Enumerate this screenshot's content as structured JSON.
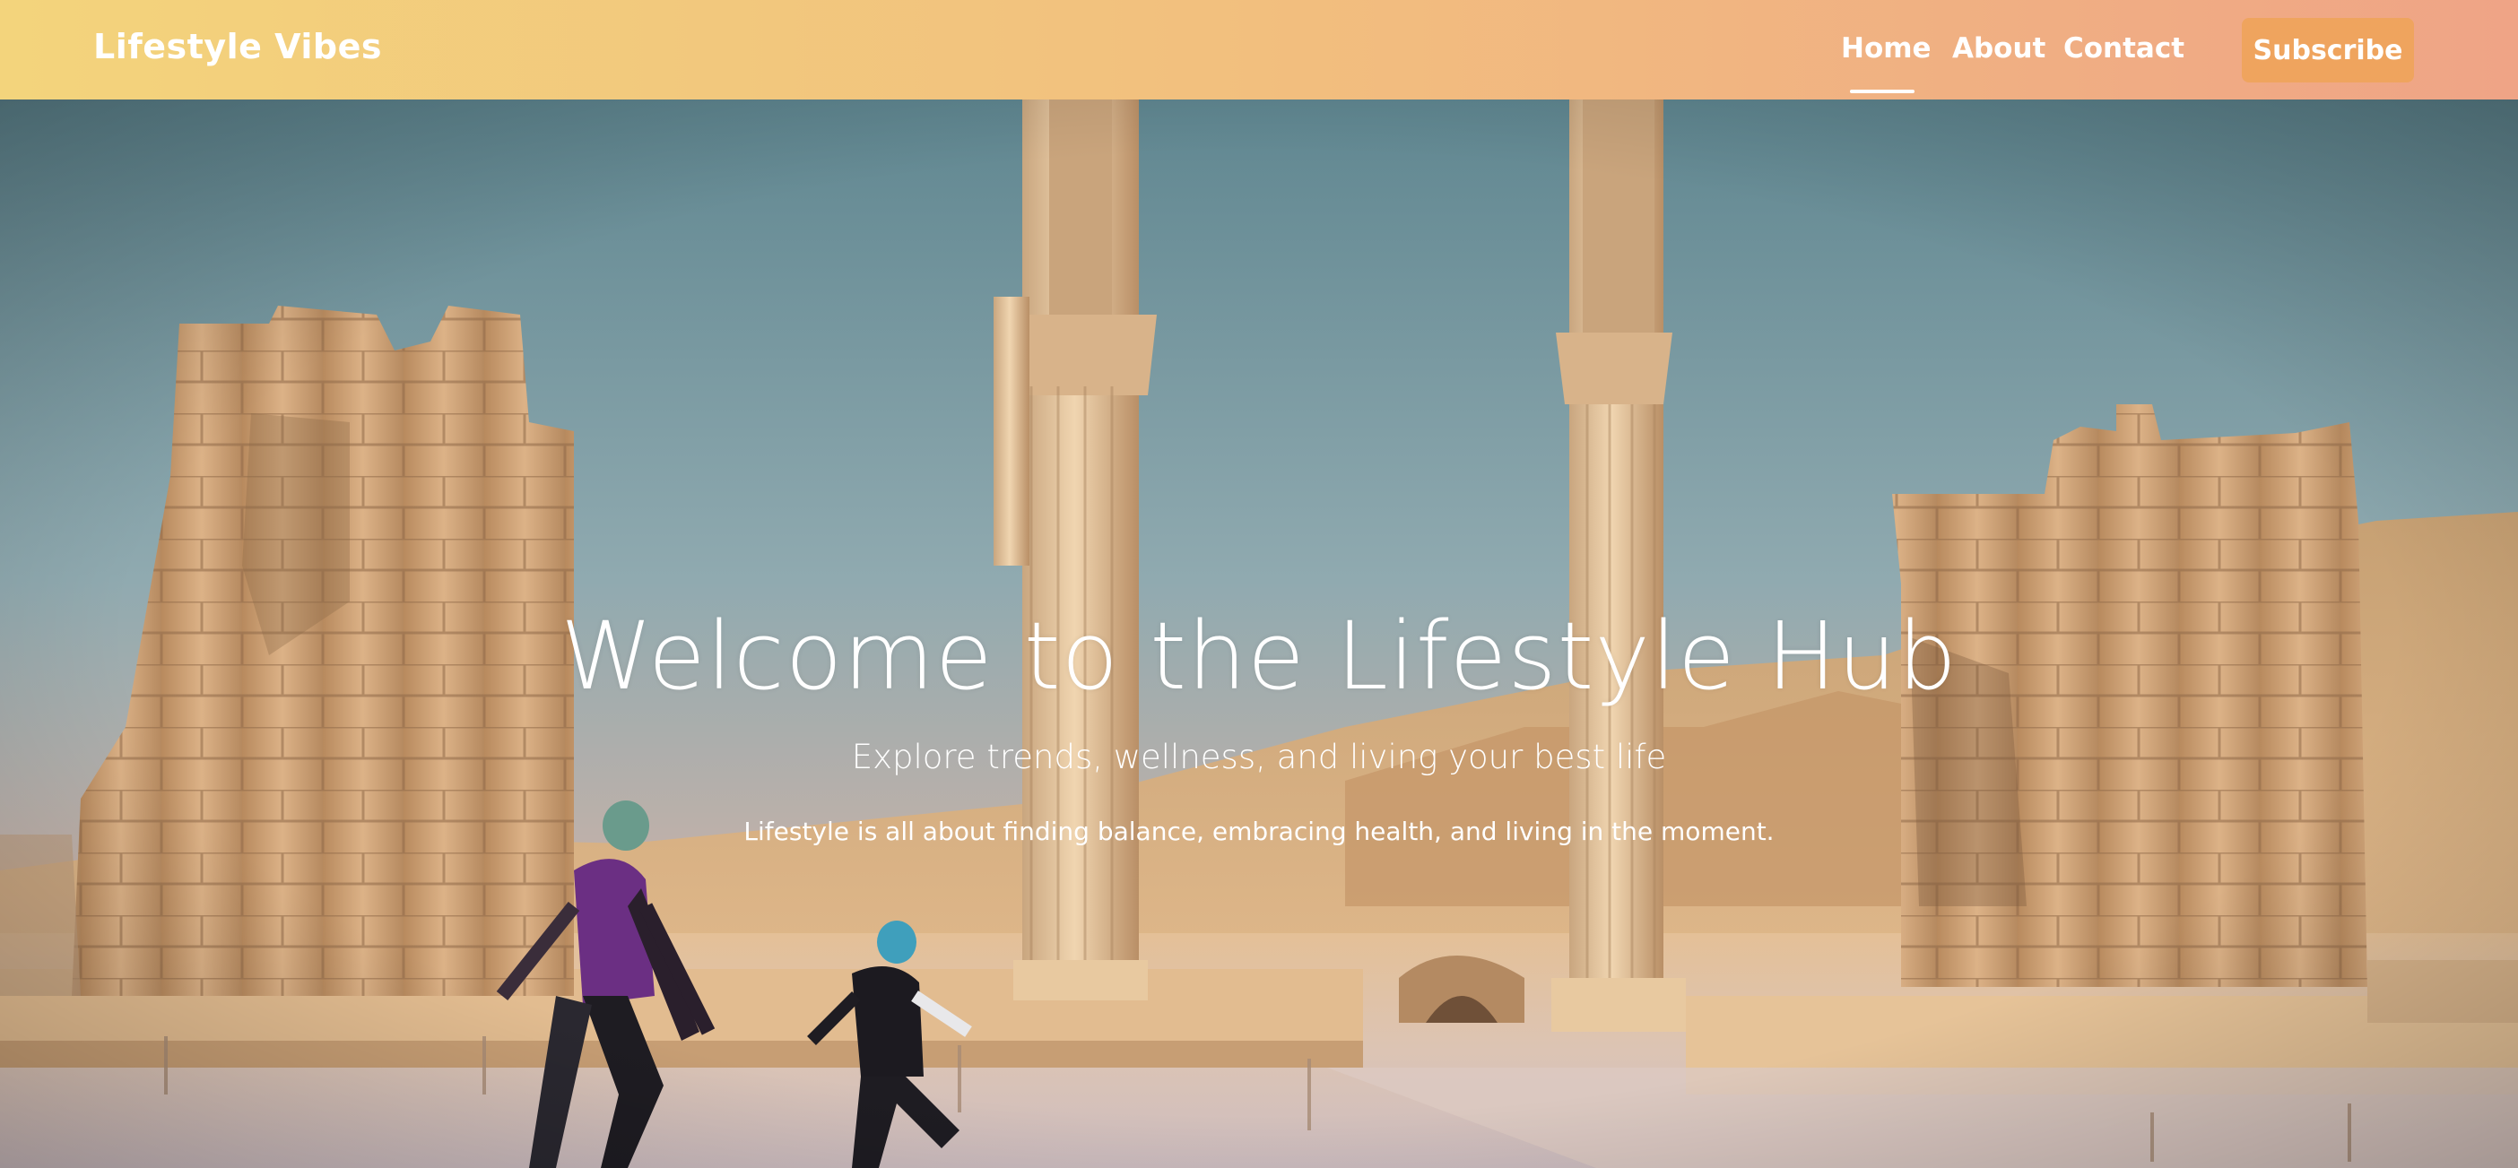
{
  "navbar": {
    "brand": "Lifestyle Vibes",
    "links": [
      {
        "label": "Home",
        "active": true
      },
      {
        "label": "About",
        "active": false
      },
      {
        "label": "Contact",
        "active": false
      }
    ],
    "subscribe_label": "Subscribe",
    "gradient_colors": [
      "#f3d47c",
      "#efa486"
    ],
    "button_color": "#efa45e"
  },
  "hero": {
    "title": "Welcome to the Lifestyle Hub",
    "subtitle": "Explore trends, wellness, and living your best life",
    "body": "Lifestyle is all about finding balance, embracing health, and living in the moment."
  }
}
